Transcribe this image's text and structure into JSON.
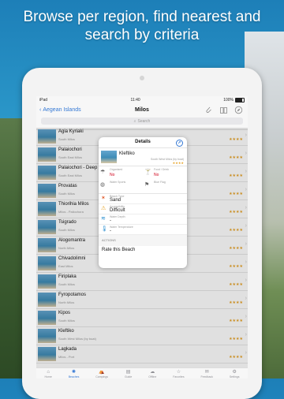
{
  "headline": "Browse per region, find nearest and search by criteria",
  "status": {
    "carrier": "iPad",
    "time": "11:40",
    "battery": "100%"
  },
  "nav": {
    "back_label": "Aegean Islands",
    "title": "Milos"
  },
  "search": {
    "placeholder": "Search"
  },
  "beaches": [
    {
      "name": "Agia Kyriaki",
      "region": "South Milos",
      "stars": "★★★★"
    },
    {
      "name": "Palaiochori",
      "region": "South East Milos",
      "stars": "★★★★"
    },
    {
      "name": "Palaiochori - Deep B",
      "region": "South East Milos",
      "stars": "★★★★"
    },
    {
      "name": "Provatas",
      "region": "South Milos",
      "stars": "★★★★"
    },
    {
      "name": "Thiorihia Milos",
      "region": "Milos - Paliochora",
      "stars": "★★★★"
    },
    {
      "name": "Tsigrado",
      "region": "South Milos",
      "stars": "★★★★"
    },
    {
      "name": "Alogomantra",
      "region": "North Milos",
      "stars": "★★★★"
    },
    {
      "name": "Chivadolimni",
      "region": "East Milos",
      "stars": "★★★★"
    },
    {
      "name": "Firiplaka",
      "region": "South Milos",
      "stars": "★★★★"
    },
    {
      "name": "Fyropotamos",
      "region": "North Milos",
      "stars": "★★★★"
    },
    {
      "name": "Kipos",
      "region": "South Milos",
      "stars": "★★★★"
    },
    {
      "name": "Kleftiko",
      "region": "South West Milos (by boat)",
      "stars": "★★★★"
    },
    {
      "name": "Lagkada",
      "region": "Milos - Port",
      "stars": "★★★★"
    }
  ],
  "details": {
    "title": "Details",
    "beach_name": "Kleftiko",
    "beach_location": "South West Milos (by boat)",
    "stars": "★★★★",
    "amenities": [
      {
        "label": "Organised",
        "value": "No",
        "icon": "umbrella-icon"
      },
      {
        "label": "Food / Drink",
        "value": "No",
        "icon": "drink-icon"
      },
      {
        "label": "Water Sports",
        "value": "",
        "icon": "ball-icon"
      },
      {
        "label": "Blue Flag",
        "value": "",
        "icon": "flag-icon"
      }
    ],
    "specs": [
      {
        "label": "Beach Type",
        "value": "Sand",
        "icon": "star-icon"
      },
      {
        "label": "Accessibility",
        "value": "Difficult",
        "icon": "warning-icon"
      },
      {
        "label": "Water Depth",
        "value": "-",
        "icon": "depth-icon"
      },
      {
        "label": "Water Temperature",
        "value": "-",
        "icon": "thermometer-icon"
      }
    ],
    "actions_header": "ACTIONS",
    "rate_label": "Rate this Beach"
  },
  "tabs": [
    {
      "label": "Home",
      "icon": "home-icon"
    },
    {
      "label": "Beaches",
      "icon": "beaches-icon"
    },
    {
      "label": "Campings",
      "icon": "camping-icon"
    },
    {
      "label": "Guide",
      "icon": "guide-icon"
    },
    {
      "label": "Offline",
      "icon": "offline-icon"
    },
    {
      "label": "Favorites",
      "icon": "favorites-icon"
    },
    {
      "label": "Feedback",
      "icon": "feedback-icon"
    },
    {
      "label": "Settings",
      "icon": "settings-icon"
    }
  ],
  "colors": {
    "accent": "#3478d4",
    "stars": "#e6a020",
    "negative": "#d0021b"
  }
}
